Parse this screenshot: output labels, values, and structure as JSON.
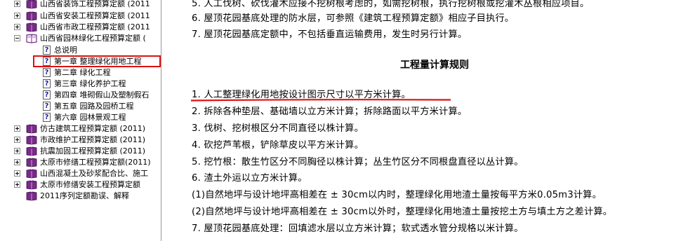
{
  "tree": {
    "items": [
      {
        "label": "山西省装饰工程预算定额 (2011"
      },
      {
        "label": "山西省安装工程预算定额 (2011"
      },
      {
        "label": "山西省市政工程预算定额 (2011"
      },
      {
        "label": "山西省园林绿化工程预算定额 ("
      },
      {
        "label": "总说明"
      },
      {
        "label": "第一章 整理绿化用地工程"
      },
      {
        "label": "第二章 绿化工程"
      },
      {
        "label": "第三章 绿化养护工程"
      },
      {
        "label": "第四章 堆砌假山及塑制假石"
      },
      {
        "label": "第五章 园路及园桥工程"
      },
      {
        "label": "第六章 园林景观工程"
      },
      {
        "label": "仿古建筑工程预算定额 (2011)"
      },
      {
        "label": "市政维护工程预算定额 (2011)"
      },
      {
        "label": "抗震加固工程预算定额 (2011)"
      },
      {
        "label": "太原市修缮工程预算定额(2011)"
      },
      {
        "label": "山西混凝土及砂浆配合比、施工"
      },
      {
        "label": "太原市修缮安装工程预算定额"
      },
      {
        "label": "2011序列定额勘误、解释"
      }
    ],
    "selected_index": 5,
    "colors": {
      "selection_box": "#e01010",
      "book": "#7a2a8a"
    }
  },
  "content": {
    "top_lines": [
      "5. 人工伐树、砍伐灌木应接不挖树根考虑的，如需挖树根，执行挖树根或挖灌木丛根相应项目。",
      "6. 屋顶花园基底处理的防水层，可参照《建筑工程预算定额》相应子目执行。",
      "7. 屋顶花园基底定额中，不包括垂直运输费用，发生时另行计算。"
    ],
    "heading": "工程量计算规则",
    "rules": [
      "1. 人工整理绿化用地按设计图示尺寸以平方米计算。",
      "2. 拆除各种垫层、基础墙以立方米计算；拆除路面以平方米计算。",
      "3. 伐树、挖树根区分不同直径以株计算。",
      "4. 砍挖芦苇根，铲除草皮以平方米计算。",
      "5. 挖竹根：散生竹区分不同胸径以株计算；丛生竹区分不同根盘直径以丛计算。",
      "6. 渣土外运以立方米计算。",
      "(1)自然地坪与设计地坪高相差在 ± 30cm以内时，整理绿化用地渣土量按每平方米0.05m3计算。",
      "(2)自然地坪与设计地坪高相差在 ± 30cm以外时，整理绿化用地渣土量按挖土方与填土方之差计算。",
      "7. 屋顶花园基底处理：回填滤水层以立方米计算；软式透水管分规格以米计算。"
    ],
    "colors": {
      "underline": "#e01010"
    }
  }
}
